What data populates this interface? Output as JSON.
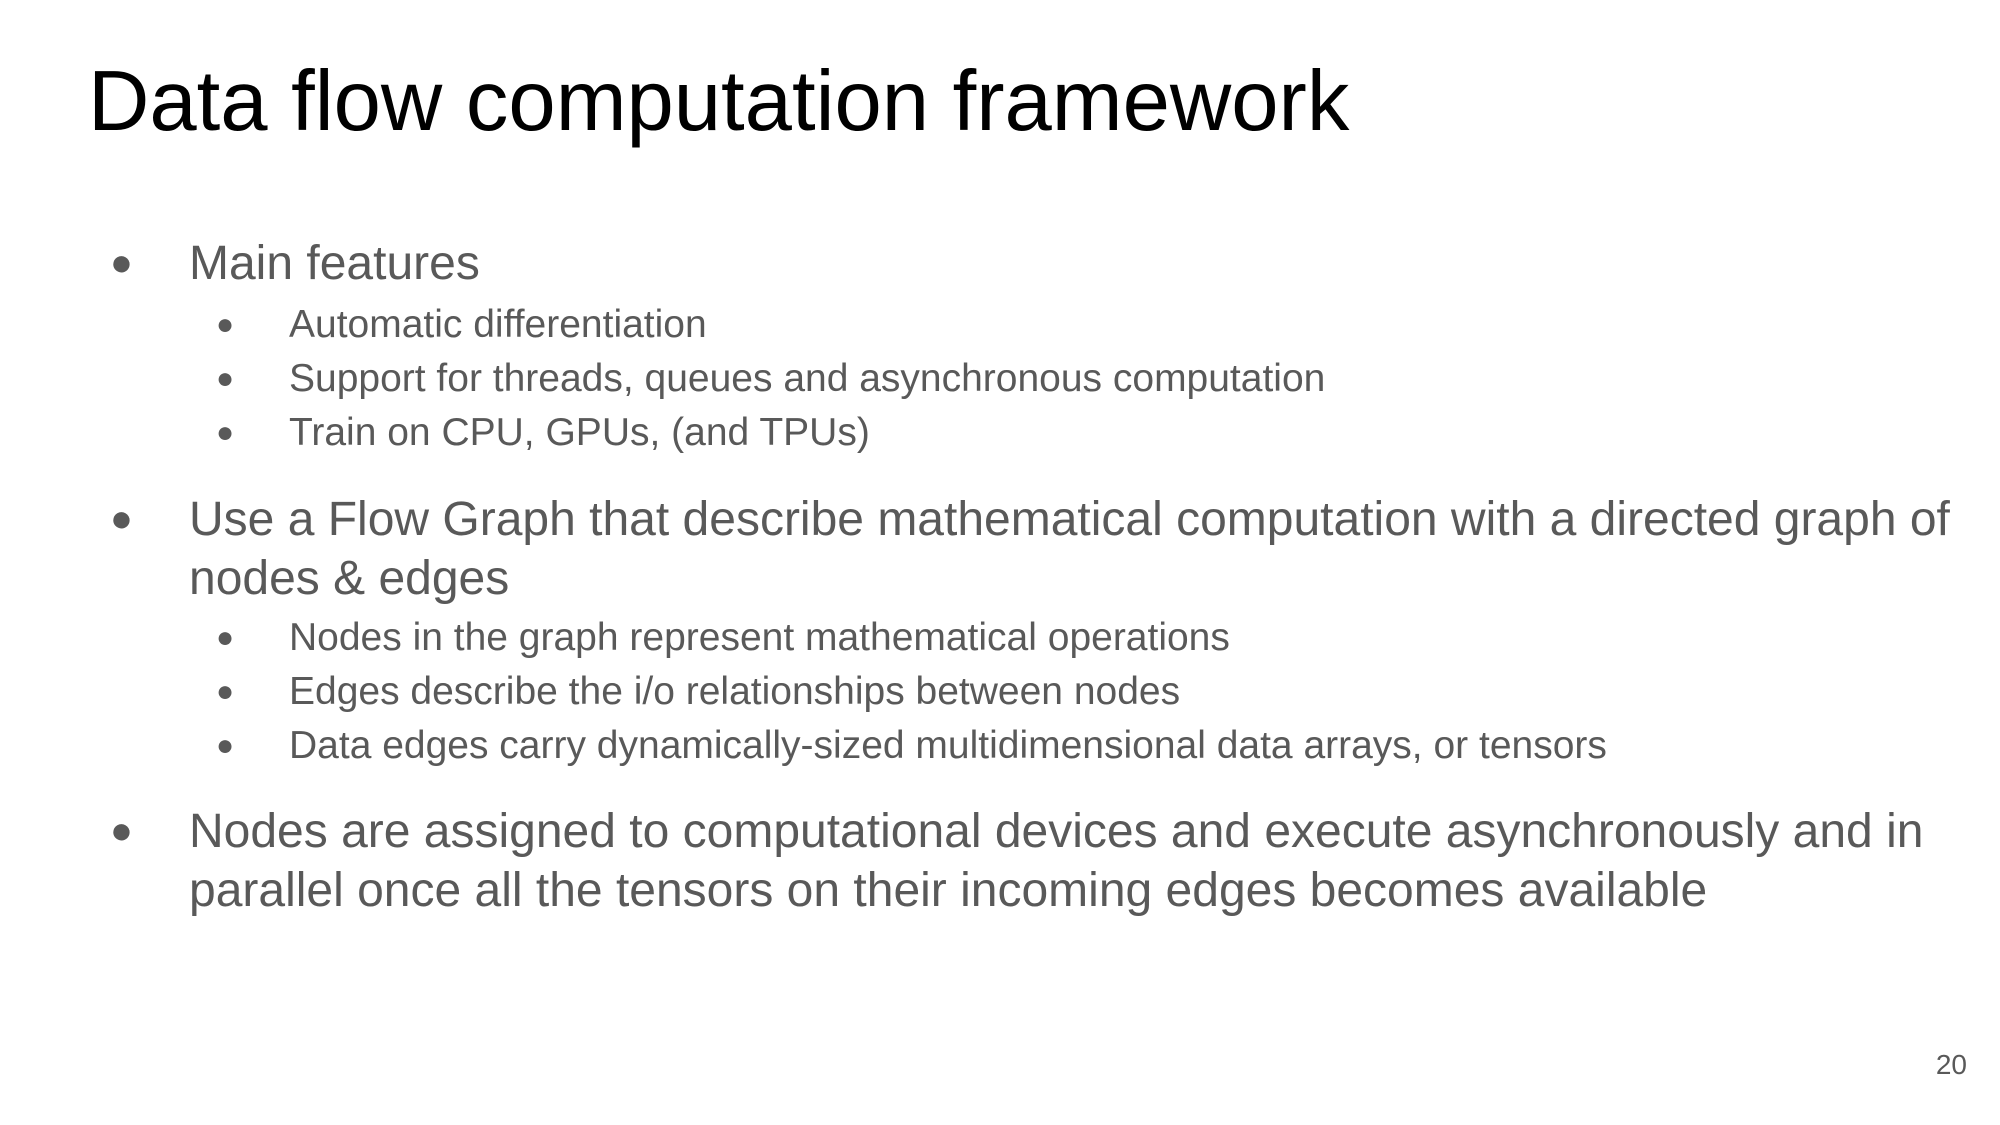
{
  "slide": {
    "title": "Data flow computation framework",
    "page_number": "20",
    "bullet_glyph": "●",
    "sections": [
      {
        "heading": "Main features",
        "items": [
          "Automatic differentiation",
          "Support for threads, queues and asynchronous computation",
          "Train on CPU, GPUs, (and TPUs)"
        ]
      },
      {
        "heading_line1": "Use a Flow Graph that describe mathematical computation with a directed graph of",
        "heading_line2": "nodes & edges",
        "items": [
          "Nodes in the graph represent mathematical operations",
          "Edges describe the i/o relationships between nodes",
          "Data edges carry dynamically-sized multidimensional data arrays, or tensors"
        ]
      },
      {
        "heading_line1": "Nodes are assigned to computational devices and execute asynchronously and in",
        "heading_line2": "parallel once all the tensors on their incoming edges becomes available"
      }
    ]
  }
}
